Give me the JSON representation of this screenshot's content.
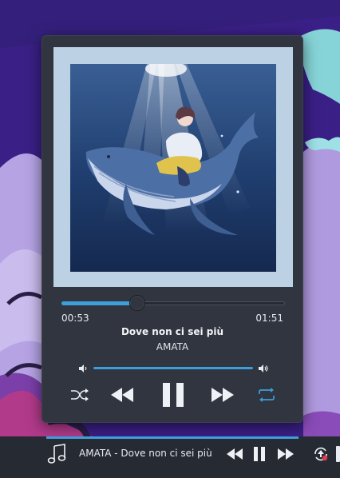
{
  "player": {
    "elapsed": "00:53",
    "total": "01:51",
    "progress_fraction": 0.34,
    "title": "Dove non ci sei più",
    "artist": "AMATA",
    "volume_fraction": 1.0,
    "accent_color": "#3d9ed9",
    "repeat_active": true,
    "shuffle_active": false,
    "state": "playing",
    "icons": {
      "volume_low": "volume-low-icon",
      "volume_high": "volume-high-icon",
      "shuffle": "shuffle-icon",
      "previous": "skip-back-icon",
      "pause": "pause-icon",
      "next": "skip-forward-icon",
      "repeat": "repeat-icon"
    }
  },
  "taskbar": {
    "now_playing_label": "AMATA - Dove non ci sei più",
    "icons": {
      "media": "music-note-icon",
      "previous": "skip-back-icon",
      "pause": "pause-icon",
      "next": "skip-forward-icon",
      "updates": "software-update-icon"
    }
  }
}
